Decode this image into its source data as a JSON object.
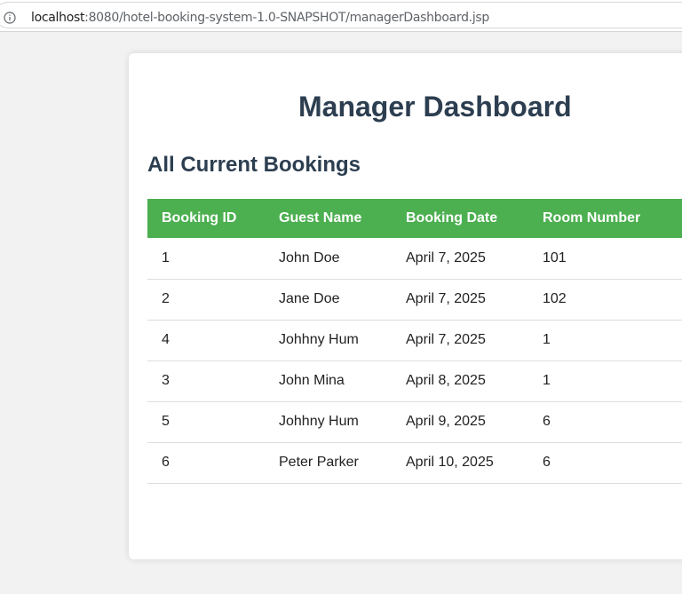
{
  "browser": {
    "url_host": "localhost",
    "url_path": ":8080/hotel-booking-system-1.0-SNAPSHOT/managerDashboard.jsp",
    "info_icon": "info-circle-icon"
  },
  "page": {
    "title": "Manager Dashboard",
    "section_title": "All Current Bookings"
  },
  "table": {
    "headers": [
      "Booking ID",
      "Guest Name",
      "Booking Date",
      "Room Number"
    ],
    "header_color": "#4caf50",
    "rows": [
      [
        "1",
        "John Doe",
        "April 7, 2025",
        "101"
      ],
      [
        "2",
        "Jane Doe",
        "April 7, 2025",
        "102"
      ],
      [
        "4",
        "Johhny Hum",
        "April 7, 2025",
        "1"
      ],
      [
        "3",
        "John Mina",
        "April 8, 2025",
        "1"
      ],
      [
        "5",
        "Johhny Hum",
        "April 9, 2025",
        "6"
      ],
      [
        "6",
        "Peter Parker",
        "April 10, 2025",
        "6"
      ]
    ]
  }
}
